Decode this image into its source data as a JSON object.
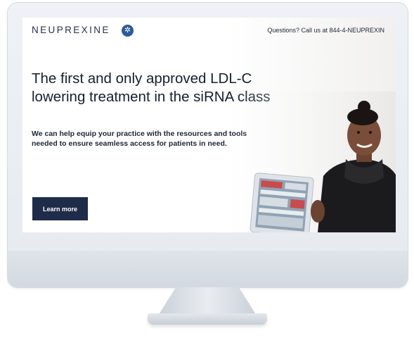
{
  "header": {
    "brand": "NEUPREXINE",
    "phone": "Questions? Call us at 844-4-NEUPREXIN"
  },
  "hero": {
    "headline": "The first and only approved LDL-C lowering treatment in the siRNA class",
    "subcopy": "We can help equip your practice with the resources and tools needed to ensure seamless access for patients in need.",
    "cta_label": "Learn more"
  },
  "colors": {
    "brand_navy": "#1f2c49",
    "logo_blue": "#2b5a9b"
  },
  "icons": {
    "logo": "brand-logo-icon"
  }
}
